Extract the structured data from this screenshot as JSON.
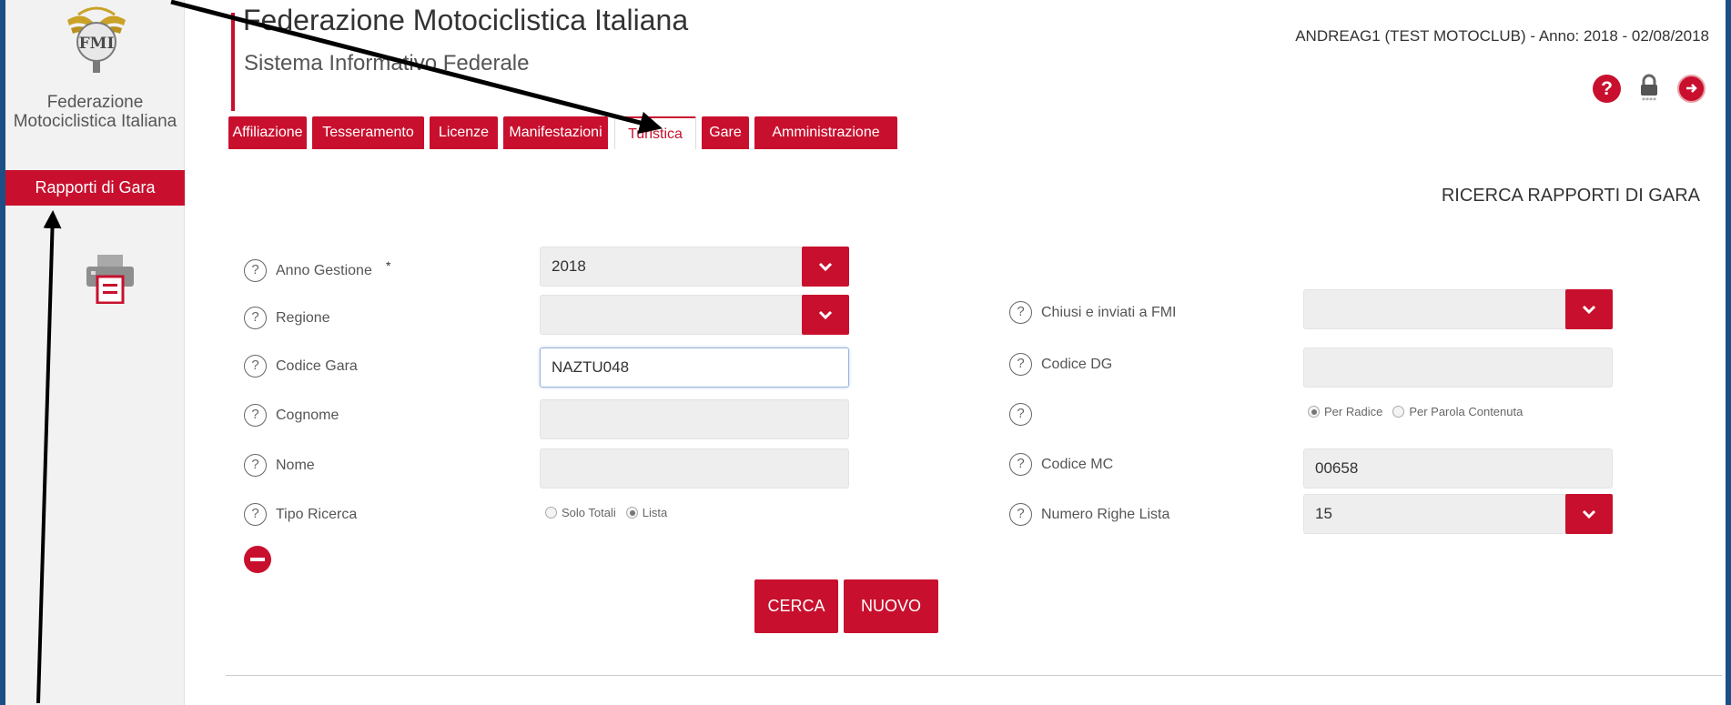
{
  "header": {
    "title": "Federazione Motociclistica Italiana",
    "subtitle": "Sistema Informativo Federale",
    "user_info": "ANDREAG1 (TEST MOTOCLUB) - Anno: 2018 - 02/08/2018",
    "help_icon_glyph": "?"
  },
  "sidebar": {
    "logo_text": "Federazione Motociclistica Italiana",
    "logo_letters": "FMI",
    "active_item": "Rapporti di Gara"
  },
  "tabs": [
    {
      "label": "Affiliazione"
    },
    {
      "label": "Tesseramento"
    },
    {
      "label": "Licenze"
    },
    {
      "label": "Manifestazioni"
    },
    {
      "label": "Turistica"
    },
    {
      "label": "Gare"
    },
    {
      "label": "Amministrazione"
    }
  ],
  "active_tab": "Turistica",
  "page_heading": "RICERCA RAPPORTI DI GARA",
  "form": {
    "anno_gestione": {
      "label": "Anno Gestione",
      "required_mark": "*",
      "value": "2018"
    },
    "regione": {
      "label": "Regione",
      "value": ""
    },
    "codice_gara": {
      "label": "Codice Gara",
      "value": "NAZTU048"
    },
    "cognome": {
      "label": "Cognome",
      "value": ""
    },
    "nome": {
      "label": "Nome",
      "value": ""
    },
    "tipo_ricerca": {
      "label": "Tipo Ricerca",
      "options": [
        "Solo Totali",
        "Lista"
      ],
      "selected": "Lista"
    },
    "chiusi_inviati": {
      "label": "Chiusi e inviati a FMI",
      "value": ""
    },
    "codice_dg": {
      "label": "Codice DG",
      "value": ""
    },
    "ricerca_mode": {
      "label": "",
      "options": [
        "Per Radice",
        "Per Parola Contenuta"
      ],
      "selected": "Per Radice"
    },
    "codice_mc": {
      "label": "Codice MC",
      "value": "00658"
    },
    "numero_righe": {
      "label": "Numero Righe Lista",
      "value": "15"
    }
  },
  "help_glyph": "?",
  "buttons": {
    "search": "CERCA",
    "new": "NUOVO"
  },
  "colors": {
    "accent": "#c8102e",
    "frame": "#1c4f86"
  }
}
